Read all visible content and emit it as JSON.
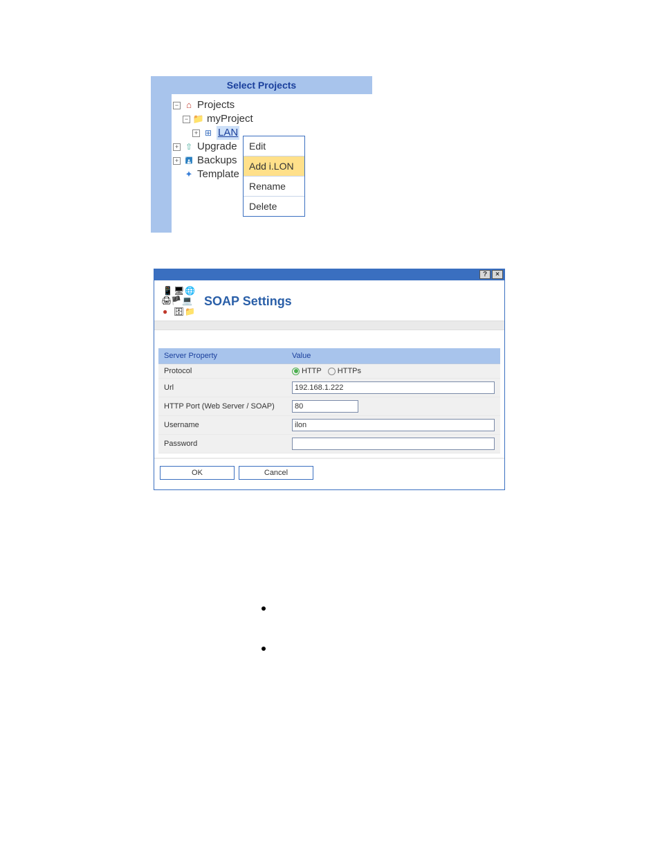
{
  "tree": {
    "title": "Select Projects",
    "items": {
      "projects": "Projects",
      "myproject": "myProject",
      "lan": "LAN",
      "upgrade": "Upgrade",
      "backups": "Backups",
      "template": "Template"
    }
  },
  "context_menu": {
    "edit": "Edit",
    "add_ilon": "Add i.LON",
    "rename": "Rename",
    "delete": "Delete"
  },
  "dialog": {
    "title": "SOAP Settings",
    "help_label": "?",
    "close_label": "×",
    "columns": {
      "property": "Server Property",
      "value": "Value"
    },
    "rows": {
      "protocol": {
        "label": "Protocol",
        "http": "HTTP",
        "https": "HTTPs"
      },
      "url": {
        "label": "Url",
        "value": "192.168.1.222"
      },
      "port": {
        "label": "HTTP Port (Web Server / SOAP)",
        "value": "80"
      },
      "username": {
        "label": "Username",
        "value": "ilon"
      },
      "password": {
        "label": "Password",
        "value": ""
      }
    },
    "buttons": {
      "ok": "OK",
      "cancel": "Cancel"
    }
  }
}
